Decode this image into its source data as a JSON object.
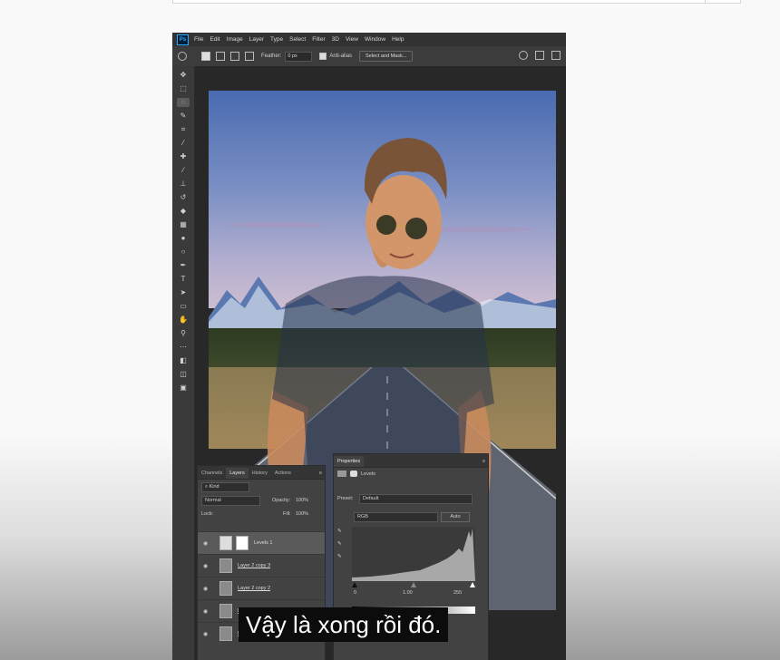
{
  "photoshop": {
    "logo": "Ps",
    "menu": [
      "File",
      "Edit",
      "Image",
      "Layer",
      "Type",
      "Select",
      "Filter",
      "3D",
      "View",
      "Window",
      "Help"
    ],
    "options": {
      "feather_label": "Feather:",
      "feather_value": "0 px",
      "anti_alias_label": "Anti-alias",
      "select_mask_button": "Select and Mask..."
    }
  },
  "layers_panel": {
    "tabs": [
      "Channels",
      "Layers",
      "History",
      "Actions"
    ],
    "active_tab": "Layers",
    "kind_label": "Kind",
    "blend_mode": "Normal",
    "opacity_label": "Opacity:",
    "opacity_value": "100%",
    "lock_label": "Lock:",
    "fill_label": "Fill:",
    "fill_value": "100%",
    "layers": [
      {
        "name": "Levels 1",
        "selected": true
      },
      {
        "name": "Layer 2 copy 3",
        "selected": false
      },
      {
        "name": "Layer 2 copy 2",
        "selected": false
      },
      {
        "name": "La",
        "selected": false
      },
      {
        "name": "La",
        "selected": false
      }
    ]
  },
  "properties_panel": {
    "title": "Properties",
    "adjustment_label": "Levels",
    "preset_label": "Preset:",
    "preset_value": "Default",
    "channel_value": "RGB",
    "auto_button": "Auto",
    "input_black": "0",
    "input_gamma": "1.00",
    "input_white": "255"
  },
  "subtitle": "Vậy là xong rồi đó."
}
